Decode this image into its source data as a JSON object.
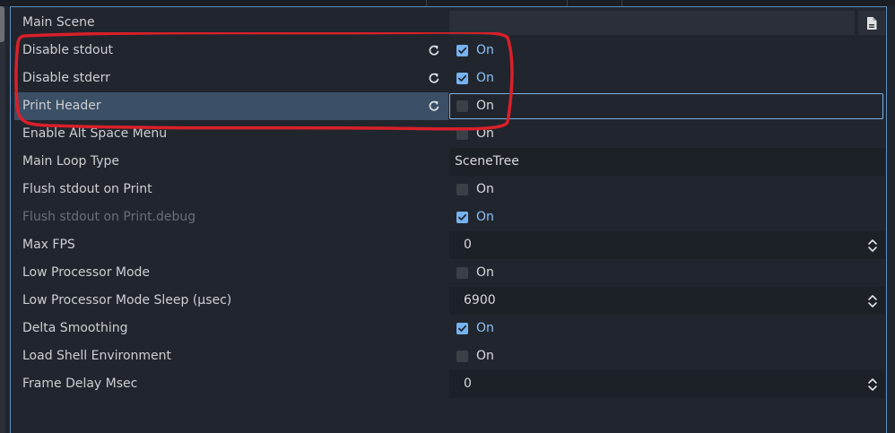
{
  "inspector": {
    "rows": [
      {
        "label": "Main Scene",
        "type": "file",
        "icon": "file-icon"
      },
      {
        "label": "Disable stdout",
        "type": "check",
        "checked": true,
        "value": "On",
        "revert": true
      },
      {
        "label": "Disable stderr",
        "type": "check",
        "checked": true,
        "value": "On",
        "revert": true
      },
      {
        "label": "Print Header",
        "type": "check",
        "checked": false,
        "value": "On",
        "revert": true,
        "selected": true,
        "focused": true
      },
      {
        "label": "Enable Alt Space Menu",
        "type": "check",
        "checked": false,
        "value": "On"
      },
      {
        "label": "Main Loop Type",
        "type": "text",
        "value": "SceneTree"
      },
      {
        "label": "Flush stdout on Print",
        "type": "check",
        "checked": false,
        "value": "On"
      },
      {
        "label": "Flush stdout on Print.debug",
        "type": "check",
        "checked": true,
        "value": "On",
        "disabled": true
      },
      {
        "label": "Max FPS",
        "type": "number",
        "value": "0"
      },
      {
        "label": "Low Processor Mode",
        "type": "check",
        "checked": false,
        "value": "On"
      },
      {
        "label": "Low Processor Mode Sleep (µsec)",
        "type": "number",
        "value": "6900"
      },
      {
        "label": "Delta Smoothing",
        "type": "check",
        "checked": true,
        "value": "On"
      },
      {
        "label": "Load Shell Environment",
        "type": "check",
        "checked": false,
        "value": "On"
      },
      {
        "label": "Frame Delay Msec",
        "type": "number",
        "value": "0"
      }
    ]
  },
  "colors": {
    "accent": "#76b3f0",
    "selection": "#3b4f66",
    "annotation": "#d9202a"
  }
}
